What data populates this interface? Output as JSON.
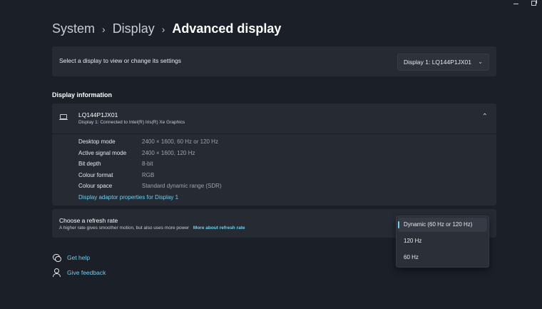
{
  "window_controls": {
    "minimize": "minimize-icon",
    "restore": "restore-icon"
  },
  "breadcrumb": {
    "items": [
      "System",
      "Display"
    ],
    "current": "Advanced display",
    "separator": "›"
  },
  "display_select": {
    "label": "Select a display to view or change its settings",
    "value": "Display 1: LQ144P1JX01",
    "icon": "chevron-down-icon"
  },
  "display_info": {
    "section_title": "Display information",
    "monitor_name": "LQ144P1JX01",
    "monitor_sub": "Display 1: Connected to Intel(R) Iris(R) Xe Graphics",
    "icon": "laptop-icon",
    "collapse_icon": "chevron-up-icon",
    "properties": [
      {
        "label": "Desktop mode",
        "value": "2400 × 1600, 60 Hz or 120 Hz"
      },
      {
        "label": "Active signal mode",
        "value": "2400 × 1600, 120 Hz"
      },
      {
        "label": "Bit depth",
        "value": "8-bit"
      },
      {
        "label": "Colour format",
        "value": "RGB"
      },
      {
        "label": "Colour space",
        "value": "Standard dynamic range (SDR)"
      }
    ],
    "adaptor_link": "Display adaptor properties for Display 1"
  },
  "refresh_rate": {
    "title": "Choose a refresh rate",
    "subtitle": "A higher rate gives smoother motion, but also uses more power",
    "link": "More about refresh rate",
    "options": [
      "Dynamic (60 Hz or 120 Hz)",
      "120 Hz",
      "60 Hz"
    ],
    "selected_index": 0
  },
  "help": {
    "get_help": "Get help",
    "give_feedback": "Give feedback"
  },
  "colors": {
    "background": "#1b1f28",
    "card": "#262a33",
    "accent": "#6dd0ee",
    "text": "#ffffff",
    "muted": "#9ea3ad"
  }
}
